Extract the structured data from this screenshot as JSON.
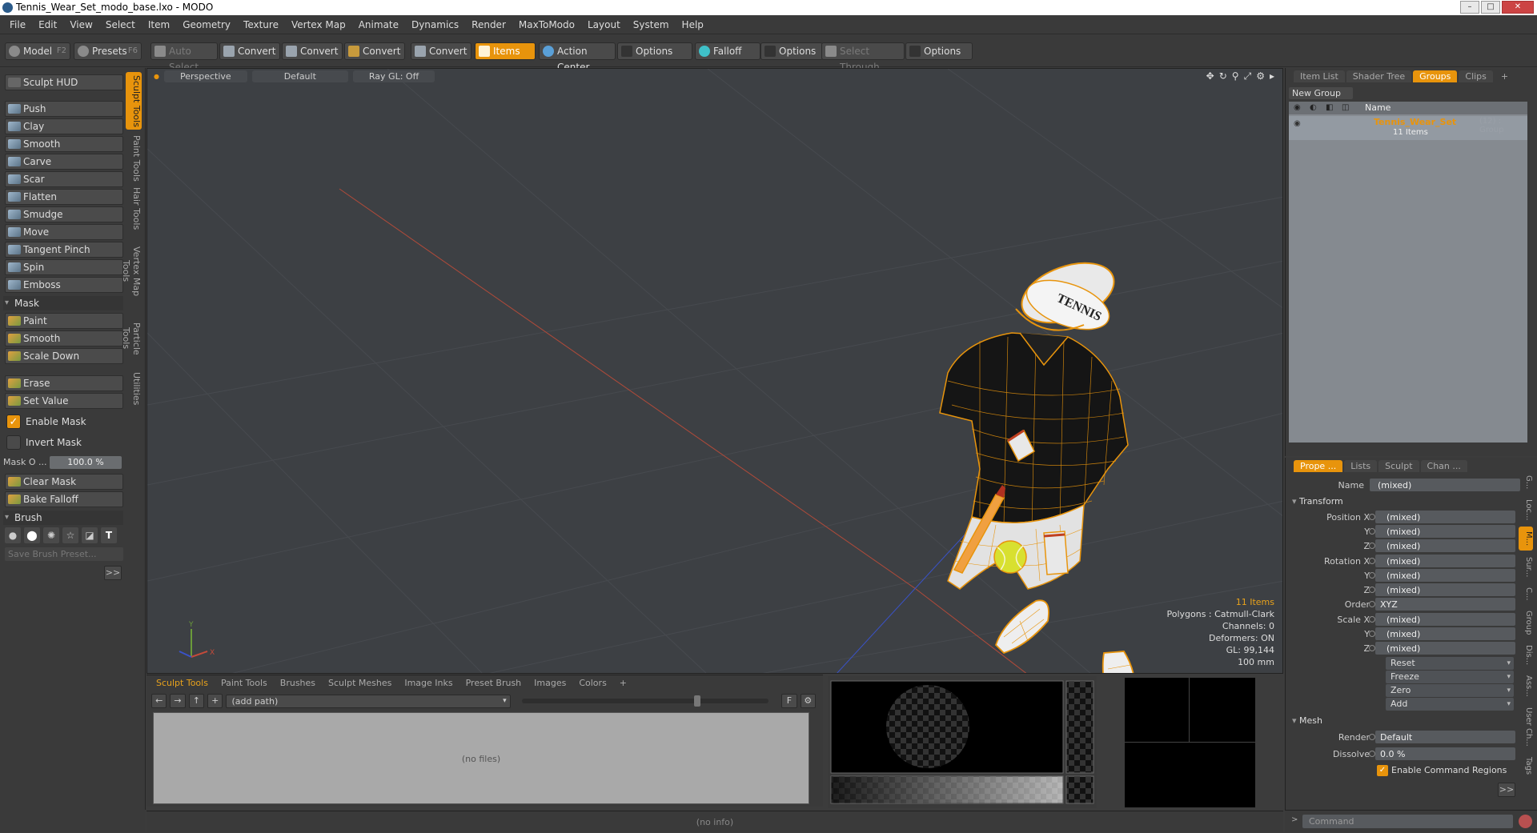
{
  "window": {
    "title": "Tennis_Wear_Set_modo_base.lxo - MODO"
  },
  "menu": [
    "File",
    "Edit",
    "View",
    "Select",
    "Item",
    "Geometry",
    "Texture",
    "Vertex Map",
    "Animate",
    "Dynamics",
    "Render",
    "MaxToModo",
    "Layout",
    "System",
    "Help"
  ],
  "toolbar": {
    "model": "Model",
    "model_key": "F2",
    "presets": "Presets",
    "presets_key": "F6",
    "auto_select": "Auto Select",
    "convert1": "Convert",
    "convert2": "Convert",
    "convert3": "Convert",
    "convert4": "Convert",
    "items": "Items",
    "action_center": "Action Center",
    "options1": "Options",
    "falloff": "Falloff",
    "options2": "Options",
    "select_through": "Select Through",
    "options3": "Options"
  },
  "left": {
    "sculpt_hud": "Sculpt HUD",
    "tools": [
      "Push",
      "Clay",
      "Smooth",
      "Carve",
      "Scar",
      "Flatten",
      "Smudge",
      "Move",
      "Tangent Pinch",
      "Spin",
      "Emboss"
    ],
    "mask_header": "Mask",
    "mask_tools": [
      "Paint",
      "Smooth",
      "Scale Down"
    ],
    "erase": "Erase",
    "set_value": "Set Value",
    "enable_mask": "Enable Mask",
    "invert_mask": "Invert Mask",
    "mask_opacity_label": "Mask O ...",
    "mask_opacity_value": "100.0 %",
    "clear_mask": "Clear Mask",
    "bake_falloff": "Bake Falloff",
    "brush_header": "Brush",
    "save_brush": "Save Brush Preset...",
    "more": ">>",
    "vtabs": [
      "Sculpt Tools",
      "Paint Tools",
      "Hair Tools",
      "Vertex Map Tools",
      "Particle Tools",
      "Utilities"
    ]
  },
  "viewport": {
    "view": "Perspective",
    "shading": "Default",
    "raygl": "Ray GL: Off",
    "info": {
      "items": "11 Items",
      "polygons": "Polygons : Catmull-Clark",
      "channels": "Channels: 0",
      "deformers": "Deformers: ON",
      "gl": "GL: 99,144",
      "scale": "100 mm"
    },
    "cap_text": "TENNIS"
  },
  "scene": {
    "tabs": [
      "Item List",
      "Shader Tree",
      "Groups",
      "Clips"
    ],
    "active_tab": "Groups",
    "new_group": "New Group",
    "col_name": "Name",
    "group_name": "Tennis_Wear_Set",
    "group_meta": "(12) : Group",
    "group_items": "11 Items"
  },
  "properties": {
    "tabs": [
      "Prope ...",
      "Lists",
      "Sculpt",
      "Chan ..."
    ],
    "name_label": "Name",
    "name_value": "(mixed)",
    "transform_header": "Transform",
    "position_label": "Position X",
    "rotation_label": "Rotation X",
    "scale_label": "Scale X",
    "y": "Y",
    "z": "Z",
    "mixed": "(mixed)",
    "order_label": "Order",
    "order_value": "XYZ",
    "actions": [
      "Reset",
      "Freeze",
      "Zero",
      "Add"
    ],
    "mesh_header": "Mesh",
    "render_label": "Render",
    "render_value": "Default",
    "dissolve_label": "Dissolve",
    "dissolve_value": "0.0 %",
    "enable_cmd": "Enable Command Regions",
    "more": ">>",
    "vtabs": [
      "G...",
      "Loc...",
      "M...",
      "Sur...",
      "C...",
      "Group",
      "Dis...",
      "Ass...",
      "User Ch...",
      "Tags"
    ]
  },
  "bottom": {
    "tabs": [
      "Sculpt Tools",
      "Paint Tools",
      "Brushes",
      "Sculpt Meshes",
      "Image Inks",
      "Preset Brush",
      "Images",
      "Colors"
    ],
    "path": "(add path)",
    "no_files": "(no files)",
    "f": "F"
  },
  "status": {
    "info": "(no info)"
  },
  "command": {
    "placeholder": "Command"
  }
}
